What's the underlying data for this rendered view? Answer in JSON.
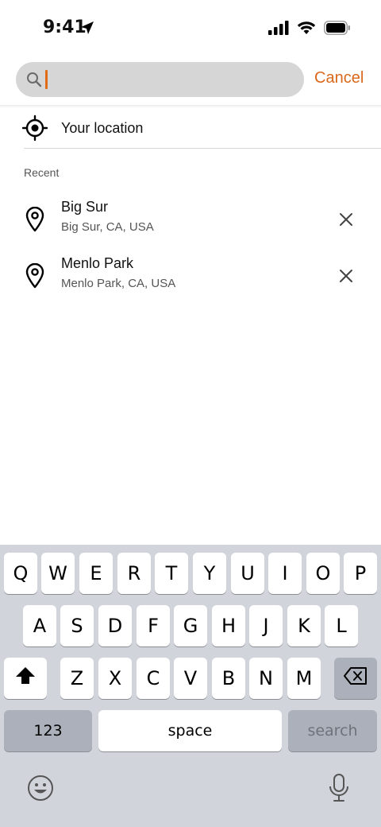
{
  "status_bar": {
    "time": "9:41"
  },
  "search": {
    "value": "",
    "placeholder": "",
    "cancel_label": "Cancel"
  },
  "your_location": {
    "label": "Your location"
  },
  "recent": {
    "header": "Recent",
    "items": [
      {
        "title": "Big Sur",
        "subtitle": "Big Sur, CA, USA"
      },
      {
        "title": "Menlo Park",
        "subtitle": "Menlo Park, CA, USA"
      }
    ]
  },
  "keyboard": {
    "row1": [
      "Q",
      "W",
      "E",
      "R",
      "T",
      "Y",
      "U",
      "I",
      "O",
      "P"
    ],
    "row2": [
      "A",
      "S",
      "D",
      "F",
      "G",
      "H",
      "J",
      "K",
      "L"
    ],
    "row3": [
      "Z",
      "X",
      "C",
      "V",
      "B",
      "N",
      "M"
    ],
    "numbers_label": "123",
    "space_label": "space",
    "search_label": "search"
  },
  "colors": {
    "accent": "#d9681a",
    "keyboard_bg": "#d1d4db",
    "search_bg": "#d6d6d6"
  },
  "icons": [
    "location-arrow-icon",
    "signal-icon",
    "wifi-icon",
    "battery-icon",
    "search-icon",
    "target-icon",
    "map-pin-icon",
    "close-icon",
    "shift-icon",
    "backspace-icon",
    "emoji-icon",
    "microphone-icon"
  ]
}
